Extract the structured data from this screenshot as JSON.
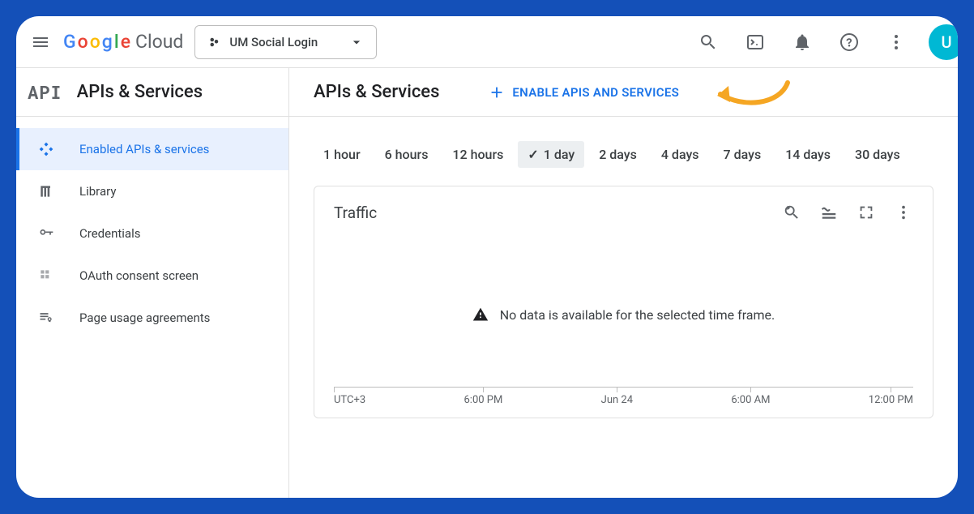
{
  "header": {
    "brand_word": "Google",
    "brand_suffix": "Cloud",
    "project_name": "UM Social Login",
    "avatar_initial": "U"
  },
  "sidebar": {
    "title": "APIs & Services",
    "items": [
      {
        "label": "Enabled APIs & services",
        "icon": "diamond-icon",
        "active": true
      },
      {
        "label": "Library",
        "icon": "library-icon",
        "active": false
      },
      {
        "label": "Credentials",
        "icon": "key-icon",
        "active": false
      },
      {
        "label": "OAuth consent screen",
        "icon": "consent-icon",
        "active": false
      },
      {
        "label": "Page usage agreements",
        "icon": "agreements-icon",
        "active": false
      }
    ]
  },
  "main": {
    "title": "APIs & Services",
    "enable_label": "ENABLE APIS AND SERVICES",
    "time_filters": [
      "1 hour",
      "6 hours",
      "12 hours",
      "1 day",
      "2 days",
      "4 days",
      "7 days",
      "14 days",
      "30 days"
    ],
    "selected_filter_index": 3,
    "card": {
      "title": "Traffic",
      "empty_message": "No data is available for the selected time frame."
    }
  },
  "chart_data": {
    "type": "line",
    "title": "Traffic",
    "series": [],
    "x_ticks": [
      "UTC+3",
      "6:00 PM",
      "Jun 24",
      "6:00 AM",
      "12:00 PM"
    ],
    "note": "No data is available for the selected time frame."
  }
}
